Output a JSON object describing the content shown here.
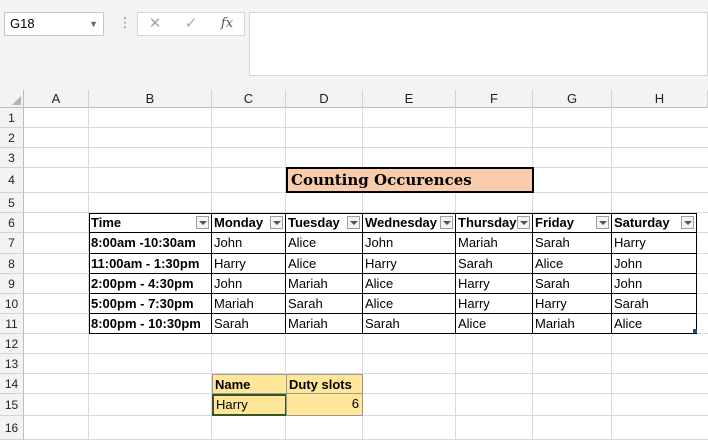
{
  "name_box": "G18",
  "formula_bar": {
    "cancel": "✕",
    "enter": "✓",
    "fx": "fx",
    "content": ""
  },
  "columns": [
    "A",
    "B",
    "C",
    "D",
    "E",
    "F",
    "G",
    "H"
  ],
  "rows": [
    "1",
    "2",
    "3",
    "4",
    "5",
    "6",
    "7",
    "8",
    "9",
    "10",
    "11",
    "12",
    "13",
    "14",
    "15",
    "16"
  ],
  "title": "Counting Occurences",
  "table": {
    "headers": [
      "Time",
      "Monday",
      "Tuesday",
      "Wednesday",
      "Thursday",
      "Friday",
      "Saturday"
    ],
    "rows": [
      [
        "8:00am -10:30am",
        "John",
        "Alice",
        "John",
        "Mariah",
        "Sarah",
        "Harry"
      ],
      [
        "11:00am - 1:30pm",
        "Harry",
        "Alice",
        "Harry",
        "Sarah",
        "Alice",
        "John"
      ],
      [
        "2:00pm - 4:30pm",
        "John",
        "Mariah",
        "Alice",
        "Harry",
        "Sarah",
        "John"
      ],
      [
        "5:00pm - 7:30pm",
        "Mariah",
        "Sarah",
        "Alice",
        "Harry",
        "Harry",
        "Sarah"
      ],
      [
        "8:00pm - 10:30pm",
        "Sarah",
        "Mariah",
        "Sarah",
        "Alice",
        "Mariah",
        "Alice"
      ]
    ]
  },
  "summary": {
    "headers": [
      "Name",
      "Duty slots"
    ],
    "name": "Harry",
    "count": "6"
  },
  "colors": {
    "title_fill": "#f8cbad",
    "summary_fill": "#ffe699",
    "selection": "#217346"
  }
}
